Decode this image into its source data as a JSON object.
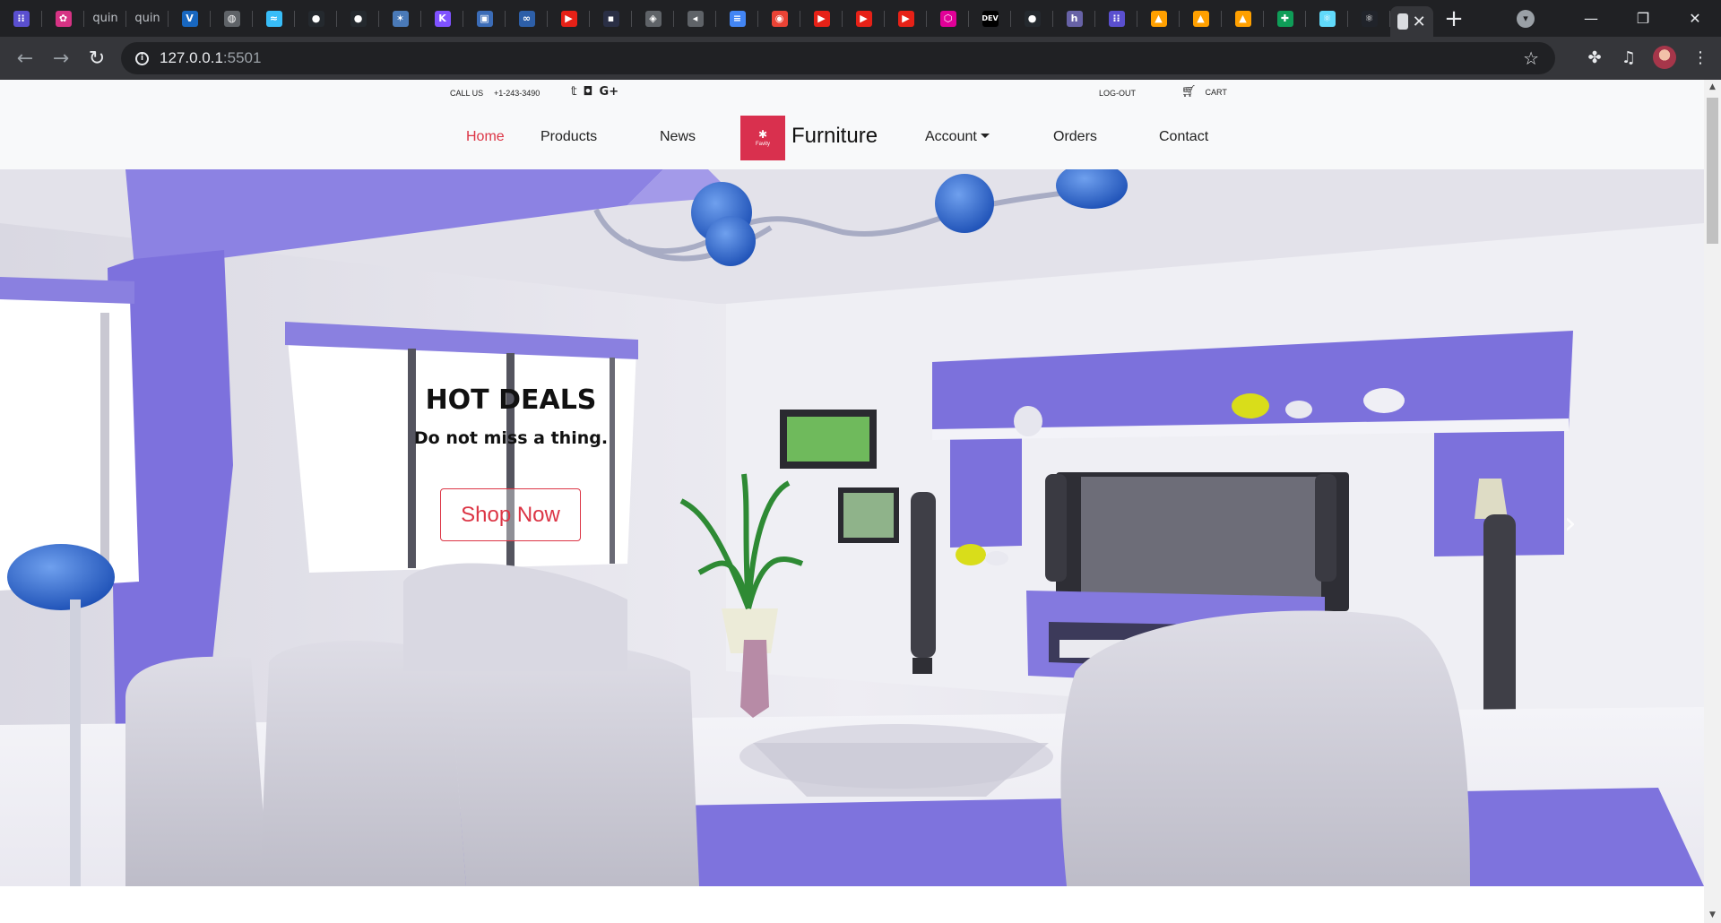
{
  "browser": {
    "tabs": [
      {
        "icon": "hostinger-bars-icon",
        "glyph": "⁝⁝",
        "color": "#5a4fcf",
        "text": ""
      },
      {
        "icon": "pink-flower-icon",
        "glyph": "✿",
        "color": "#d63384",
        "text": ""
      },
      {
        "icon": "quin-tab",
        "glyph": "",
        "color": "",
        "text": "quin"
      },
      {
        "icon": "quin-tab",
        "glyph": "",
        "color": "",
        "text": "quin"
      },
      {
        "icon": "vuetify-icon",
        "glyph": "V",
        "color": "#1867c0",
        "text": ""
      },
      {
        "icon": "globe-icon",
        "glyph": "◍",
        "color": "#5f6368",
        "text": ""
      },
      {
        "icon": "tailwind-icon",
        "glyph": "≈",
        "color": "#38bdf8",
        "text": ""
      },
      {
        "icon": "github-icon",
        "glyph": "●",
        "color": "#24292e",
        "text": ""
      },
      {
        "icon": "github-icon",
        "glyph": "●",
        "color": "#24292e",
        "text": ""
      },
      {
        "icon": "feather-icon",
        "glyph": "✶",
        "color": "#4a7ab8",
        "text": ""
      },
      {
        "icon": "kotlin-icon",
        "glyph": "K",
        "color": "#7f52ff",
        "text": ""
      },
      {
        "icon": "image-icon",
        "glyph": "▣",
        "color": "#3b6cb7",
        "text": ""
      },
      {
        "icon": "infinity-icon",
        "glyph": "∞",
        "color": "#2d5fa8",
        "text": ""
      },
      {
        "icon": "youtube-icon",
        "glyph": "▶",
        "color": "#e62117",
        "text": ""
      },
      {
        "icon": "dark-tab-icon",
        "glyph": "▪",
        "color": "#2a2f45",
        "text": ""
      },
      {
        "icon": "cube-icon",
        "glyph": "◈",
        "color": "#5f6368",
        "text": ""
      },
      {
        "icon": "speaker-icon",
        "glyph": "◂",
        "color": "#5f6368",
        "text": ""
      },
      {
        "icon": "google-docs-icon",
        "glyph": "≡",
        "color": "#4285f4",
        "text": ""
      },
      {
        "icon": "google-forms-icon",
        "glyph": "◉",
        "color": "#ea4335",
        "text": ""
      },
      {
        "icon": "youtube-icon",
        "glyph": "▶",
        "color": "#e62117",
        "text": ""
      },
      {
        "icon": "youtube-icon",
        "glyph": "▶",
        "color": "#e62117",
        "text": ""
      },
      {
        "icon": "youtube-icon",
        "glyph": "▶",
        "color": "#e62117",
        "text": ""
      },
      {
        "icon": "graphql-icon",
        "glyph": "⬡",
        "color": "#e10098",
        "text": ""
      },
      {
        "icon": "dev-icon",
        "glyph": "DEV",
        "color": "#000000",
        "text": ""
      },
      {
        "icon": "github-icon",
        "glyph": "●",
        "color": "#24292e",
        "text": ""
      },
      {
        "icon": "heroku-icon",
        "glyph": "h",
        "color": "#6762a6",
        "text": ""
      },
      {
        "icon": "hostinger-bars-icon",
        "glyph": "⁝⁝",
        "color": "#5a4fcf",
        "text": ""
      },
      {
        "icon": "firebase-icon",
        "glyph": "▲",
        "color": "#ffa000",
        "text": ""
      },
      {
        "icon": "firebase-icon",
        "glyph": "▲",
        "color": "#ffa000",
        "text": ""
      },
      {
        "icon": "firebase-icon",
        "glyph": "▲",
        "color": "#ffa000",
        "text": ""
      },
      {
        "icon": "google-sheets-icon",
        "glyph": "✚",
        "color": "#0f9d58",
        "text": ""
      },
      {
        "icon": "react-icon",
        "glyph": "⚛",
        "color": "#61dafb",
        "text": ""
      },
      {
        "icon": "react-icon",
        "glyph": "⚛",
        "color": "#20232a",
        "text": ""
      }
    ],
    "active_tab_close": "✕",
    "new_tab": "+",
    "url_host": "127.0.0.1",
    "url_port": ":5501",
    "window_minimize": "—",
    "window_restore": "❐",
    "window_close": "✕"
  },
  "topbar": {
    "call_label": "CALL US",
    "phone": "+1-243-3490",
    "logout": "LOG-OUT",
    "cart": "CART"
  },
  "nav": {
    "home": "Home",
    "products": "Products",
    "news": "News",
    "brand": "Furniture",
    "logo_text": "Favity",
    "account": "Account",
    "orders": "Orders",
    "contact": "Contact"
  },
  "hero": {
    "title": "HOT DEALS",
    "subtitle": "Do not miss a thing.",
    "button": "Shop Now",
    "prev": "‹",
    "next": "›"
  },
  "colors": {
    "accent": "#dc3545",
    "purple": "#7b6fe0",
    "nav_bg": "#f8f9fa"
  }
}
